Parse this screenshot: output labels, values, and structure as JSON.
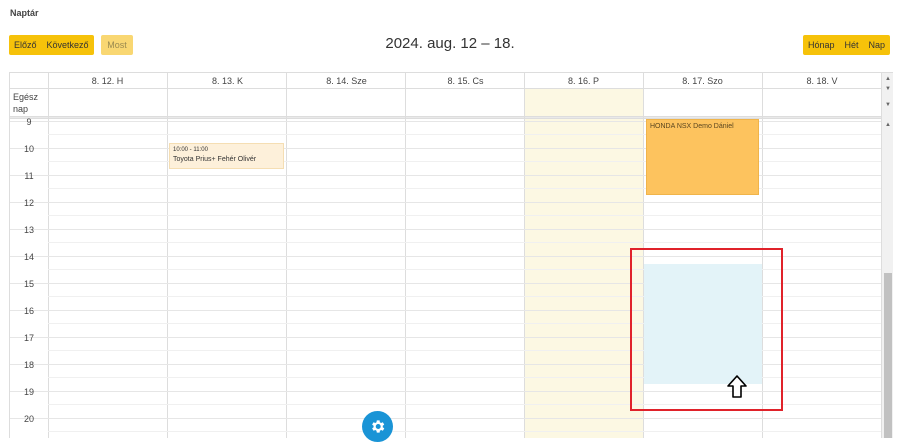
{
  "page_title": "Naptár",
  "toolbar": {
    "prev_label": "Előző",
    "next_label": "Következő",
    "now_label": "Most",
    "range_title": "2024. aug. 12 – 18.",
    "view_month": "Hónap",
    "view_week": "Hét",
    "view_day": "Nap"
  },
  "calendar": {
    "all_day_label": "Egész nap",
    "days": [
      "8. 12. H",
      "8. 13. K",
      "8. 14. Sze",
      "8. 15. Cs",
      "8. 16. P",
      "8. 17. Szo",
      "8. 18. V"
    ],
    "hours": [
      "9",
      "10",
      "11",
      "12",
      "13",
      "14",
      "15",
      "16",
      "17",
      "18",
      "19",
      "20"
    ],
    "events": [
      {
        "time": "10:00 - 11:00",
        "title": "Toyota Prius+ Fehér Olivér"
      },
      {
        "time": "",
        "title": "HONDA NSX Demo Dániel"
      }
    ]
  },
  "colors": {
    "accent": "#f6c20a",
    "today_bg": "#fcf8e3",
    "selection_bg": "#e3f3f8",
    "event_orange": "#fdc35e",
    "highlight_red": "#e0222a",
    "fab_blue": "#1a94d6"
  },
  "icons": {
    "settings": "gear-icon",
    "cursor": "arrow-up-cursor-icon"
  }
}
